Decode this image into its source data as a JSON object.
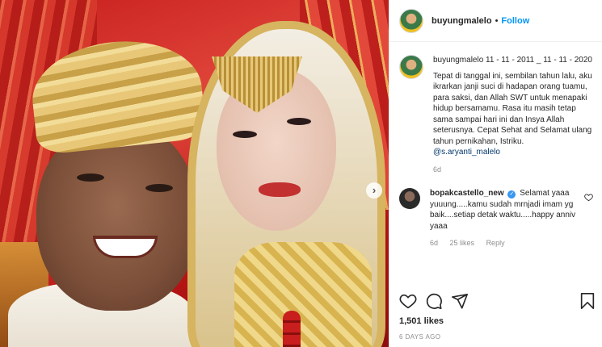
{
  "post": {
    "username": "buyungmalelo",
    "follow_label": "Follow",
    "separator": "•"
  },
  "caption": {
    "username": "buyungmalelo",
    "text": " 11 - 11 - 2011 _ 11 - 11 - 2020",
    "body": "Tepat di tanggal ini, sembilan tahun lalu, aku ikrarkan janji suci di hadapan orang tuamu, para saksi, dan Allah SWT untuk menapaki hidup bersamamu. Rasa itu masih tetap sama sampai hari ini dan Insya Allah seterusnya. Cepat Sehat and Selamat ulang tahun pernikahan, Istriku.",
    "mention": "@s.aryanti_malelo",
    "age": "6d"
  },
  "comment": {
    "username": "bopakcastello_new",
    "verified_mark": "✓",
    "text": " Selamat yaaa yuuung.....kamu sudah mrnjadi imam yg baik....setiap detak waktu.....happy anniv yaaa",
    "age": "6d",
    "likes": "25 likes",
    "reply_label": "Reply",
    "like_icon": "heart-outline-icon"
  },
  "actions": {
    "icons": [
      "heart-icon",
      "comment-icon",
      "share-icon",
      "bookmark-icon"
    ]
  },
  "likes": "1,501 likes",
  "timestamp": "6 DAYS AGO",
  "carousel": {
    "next_glyph": "›"
  },
  "colors": {
    "link_blue": "#0095f6",
    "mention_blue": "#00376b",
    "muted": "#8e8e8e",
    "text": "#262626"
  }
}
